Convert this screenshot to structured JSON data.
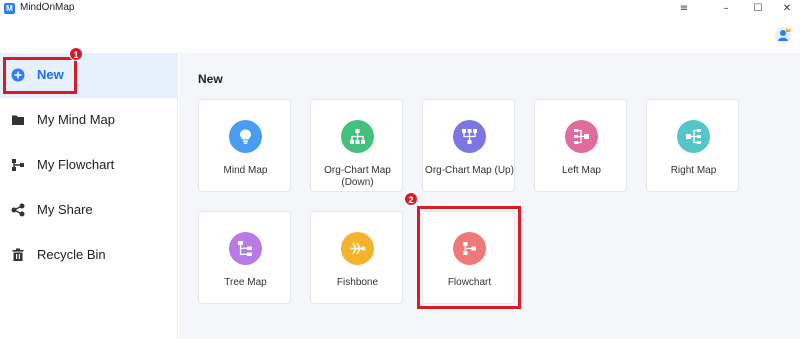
{
  "app": {
    "title": "MindOnMap",
    "logo_letter": "M",
    "window_controls": [
      "≡",
      "–",
      "☐",
      "✕"
    ]
  },
  "sidebar": {
    "items": [
      {
        "label": "New",
        "icon": "plus-circle-icon",
        "active": true
      },
      {
        "label": "My Mind Map",
        "icon": "folder-icon"
      },
      {
        "label": "My Flowchart",
        "icon": "flowchart-icon"
      },
      {
        "label": "My Share",
        "icon": "share-icon"
      },
      {
        "label": "Recycle Bin",
        "icon": "trash-icon"
      }
    ]
  },
  "main": {
    "section_title": "New",
    "templates": [
      {
        "label": "Mind Map",
        "icon": "lightbulb-icon",
        "color": "#4a9cf2"
      },
      {
        "label": "Org-Chart Map (Down)",
        "icon": "org-chart-down-icon",
        "color": "#42c17c"
      },
      {
        "label": "Org-Chart Map (Up)",
        "icon": "org-chart-up-icon",
        "color": "#7b76e3"
      },
      {
        "label": "Left Map",
        "icon": "left-map-icon",
        "color": "#e26a9c"
      },
      {
        "label": "Right Map",
        "icon": "right-map-icon",
        "color": "#54c6c9"
      },
      {
        "label": "Tree Map",
        "icon": "tree-map-icon",
        "color": "#b77ae6"
      },
      {
        "label": "Fishbone",
        "icon": "fishbone-icon",
        "color": "#f5b32c"
      },
      {
        "label": "Flowchart",
        "icon": "flowchart-icon",
        "color": "#f07878"
      }
    ]
  },
  "annotations": {
    "step1": "1",
    "step2": "2",
    "highlight_color": "#d81c27"
  }
}
